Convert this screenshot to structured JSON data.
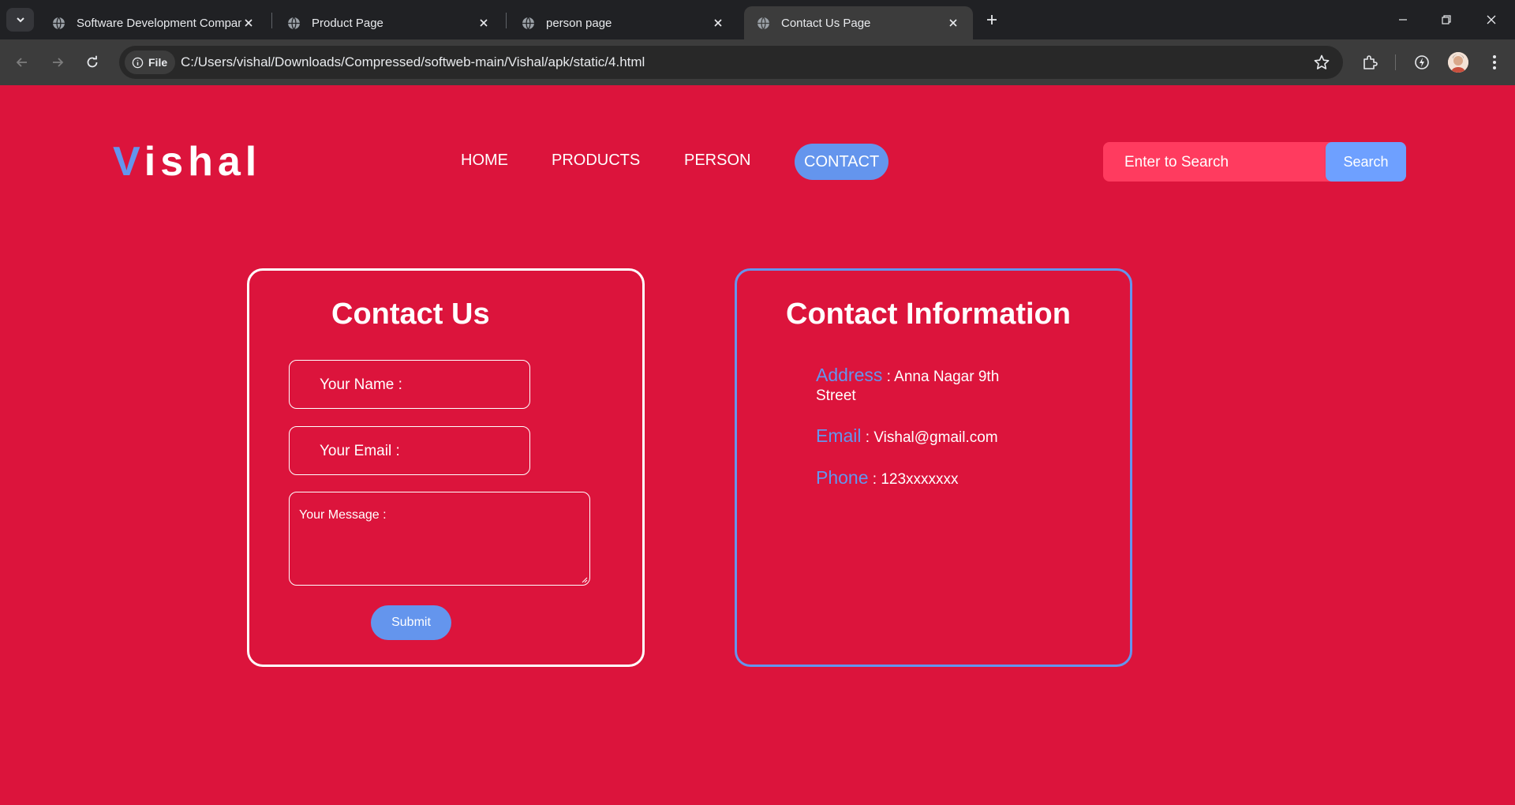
{
  "browser": {
    "tabs": [
      {
        "title": "Software Development Company"
      },
      {
        "title": "Product Page"
      },
      {
        "title": "person page"
      },
      {
        "title": "Contact Us Page"
      }
    ],
    "address": {
      "chip_label": "File",
      "url": "C:/Users/vishal/Downloads/Compressed/softweb-main/Vishal/apk/static/4.html"
    }
  },
  "site": {
    "logo_first": "V",
    "logo_rest": "ishal",
    "nav": [
      "HOME",
      "PRODUCTS",
      "PERSON",
      "CONTACT"
    ],
    "active_nav": "CONTACT",
    "search": {
      "placeholder": "Enter to Search",
      "button": "Search"
    }
  },
  "contact_form": {
    "title": "Contact Us",
    "name_placeholder": "Your Name :",
    "email_placeholder": "Your Email :",
    "message_placeholder": "Your Message :",
    "submit_label": "Submit"
  },
  "contact_info": {
    "title": "Contact Information",
    "address_label": "Address",
    "address_value": ": Anna Nagar 9th",
    "address_value_cont": "Street",
    "email_label": "Email",
    "email_value": ": Vishal@gmail.com",
    "phone_label": "Phone",
    "phone_value": ": 123xxxxxxx"
  },
  "colors": {
    "page_bg": "#dc143c",
    "accent": "#6495ed",
    "search_bg": "#ff3b5f",
    "chrome_dark": "#202124",
    "chrome_toolbar": "#3c3c3c"
  }
}
